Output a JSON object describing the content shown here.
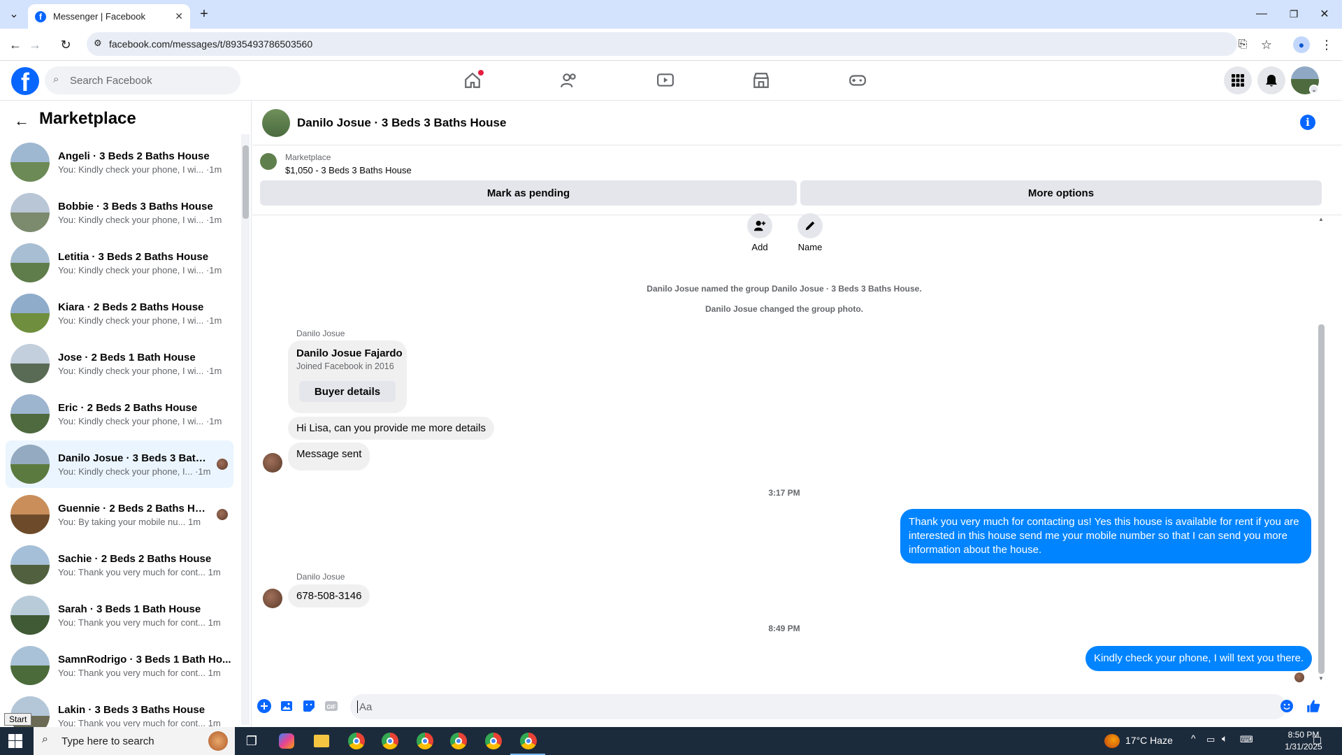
{
  "browser": {
    "tab_title": "Messenger | Facebook",
    "url": "facebook.com/messages/t/8935493786503560"
  },
  "fb": {
    "search_placeholder": "Search Facebook",
    "brand_color": "#0866ff"
  },
  "left": {
    "title": "Marketplace",
    "conversations": [
      {
        "name": "Angeli · 3 Beds 2 Baths House",
        "preview": "You: Kindly check your phone, I wi... ·1m",
        "active": false
      },
      {
        "name": "Bobbie · 3 Beds 3 Baths House",
        "preview": "You: Kindly check your phone, I wi... ·1m",
        "active": false
      },
      {
        "name": "Letitia · 3 Beds 2 Baths House",
        "preview": "You: Kindly check your phone, I wi... ·1m",
        "active": false
      },
      {
        "name": "Kiara · 2 Beds 2 Baths House",
        "preview": "You: Kindly check your phone, I wi... ·1m",
        "active": false
      },
      {
        "name": "Jose · 2 Beds 1 Bath House",
        "preview": "You: Kindly check your phone, I wi... ·1m",
        "active": false
      },
      {
        "name": "Eric · 2 Beds 2 Baths House",
        "preview": "You: Kindly check your phone, I wi... ·1m",
        "active": false
      },
      {
        "name": "Danilo Josue · 3 Beds 3 Baths ...",
        "preview": "You: Kindly check your phone, I... ·1m",
        "active": true
      },
      {
        "name": "Guennie · 2 Beds 2 Baths House",
        "preview": "You: By taking your mobile nu...    1m",
        "active": false
      },
      {
        "name": "Sachie · 2 Beds 2 Baths House",
        "preview": "You: Thank you very much for cont... 1m",
        "active": false
      },
      {
        "name": "Sarah · 3 Beds 1 Bath House",
        "preview": "You: Thank you very much for cont... 1m",
        "active": false
      },
      {
        "name": "SamnRodrigo · 3 Beds 1 Bath Ho...",
        "preview": "You: Thank you very much for cont... 1m",
        "active": false
      },
      {
        "name": "Lakin · 3 Beds 3 Baths House",
        "preview": "You: Thank you very much for cont... 1m",
        "active": false
      }
    ]
  },
  "chat": {
    "title": "Danilo Josue · 3 Beds 3 Baths House",
    "marketplace_label": "Marketplace",
    "listing": "$1,050 - 3 Beds 3 Baths House",
    "mark_pending": "Mark as pending",
    "more_options": "More options",
    "add_label": "Add",
    "name_label": "Name",
    "sys1": "Danilo Josue named the group Danilo Josue · 3 Beds 3 Baths House.",
    "sys2": "Danilo Josue changed the group photo.",
    "sender": "Danilo Josue",
    "card_name": "Danilo Josue Fajardo",
    "card_sub": "Joined Facebook in 2016",
    "buyer_details": "Buyer details",
    "msg1": "Hi Lisa, can you provide me more details",
    "msg2": "Message sent",
    "time1": "3:17 PM",
    "out1": "Thank you very much for contacting us! Yes this house is available for rent if you are interested in this house send me your mobile number so that I can send you more information about the house.",
    "sender2": "Danilo Josue",
    "msg3": "678-508-3146",
    "time2": "8:49 PM",
    "out2": "Kindly check your phone, I will text you there.",
    "composer_placeholder": "Aa",
    "out_color": "#0084ff"
  },
  "taskbar": {
    "search_placeholder": "Type here to search",
    "start_tip": "Start",
    "weather": "17°C  Haze",
    "time": "8:50 PM",
    "date": "1/31/2025"
  }
}
